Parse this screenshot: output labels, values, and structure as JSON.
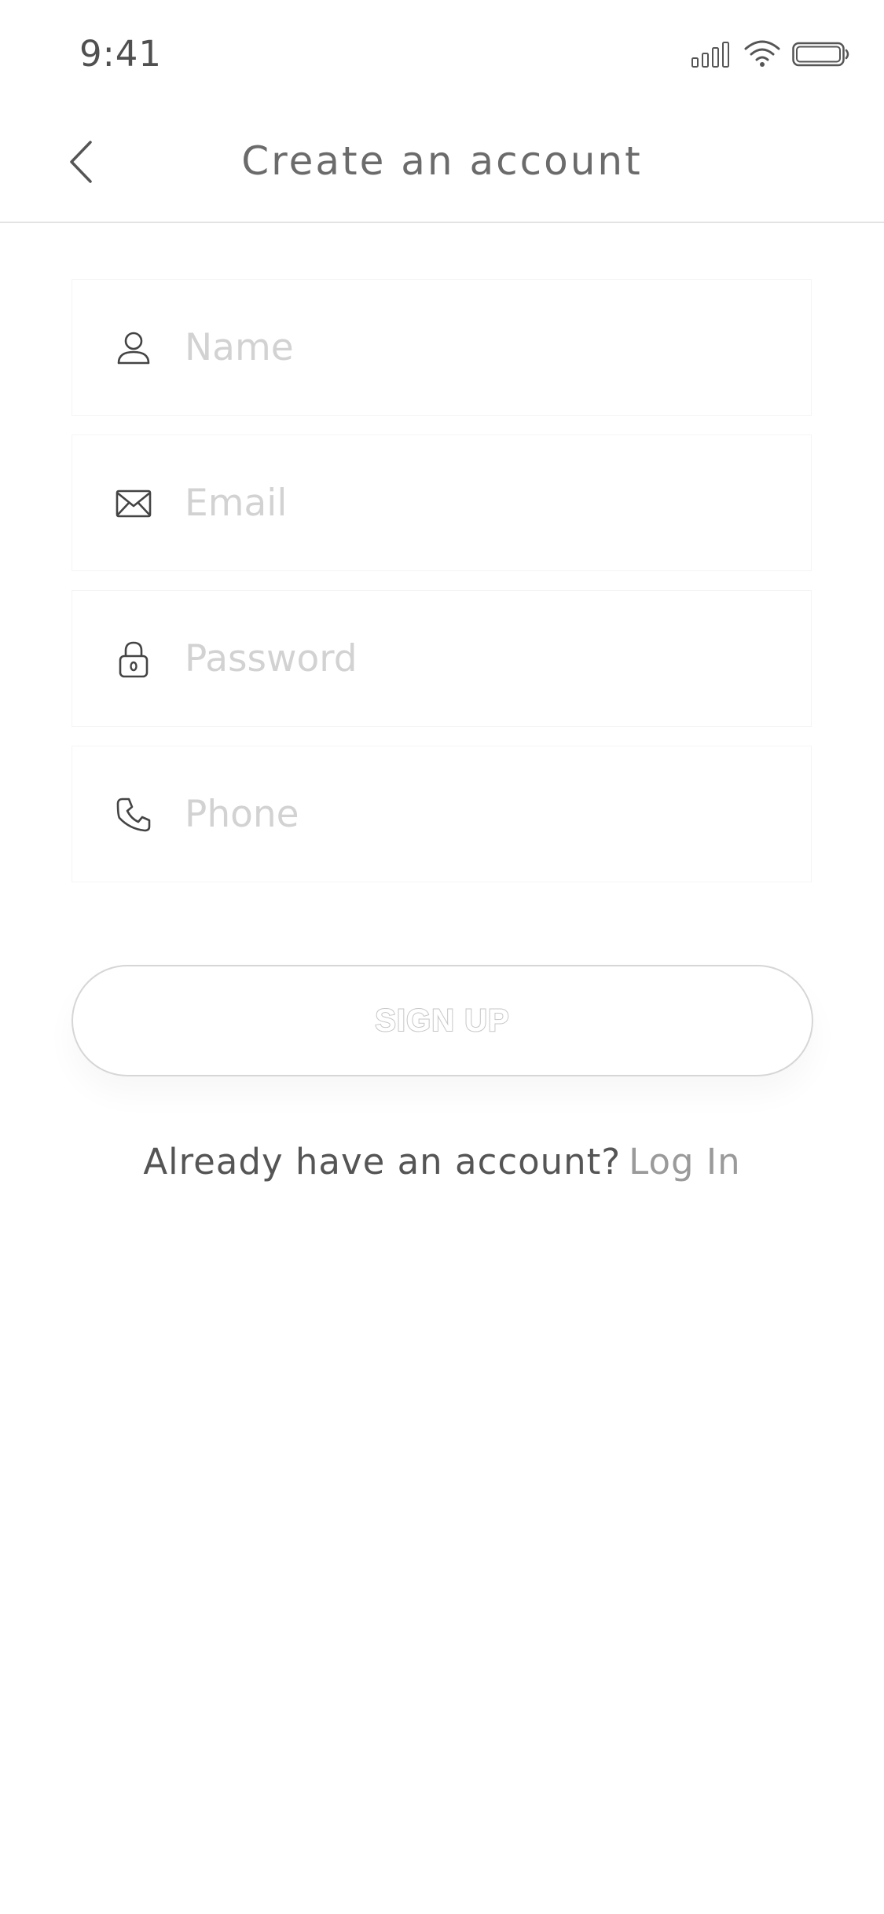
{
  "status_bar": {
    "time": "9:41",
    "icons": [
      "signal-icon",
      "wifi-icon",
      "battery-icon"
    ]
  },
  "nav": {
    "back_icon": "chevron-left-icon",
    "title": "Create an account"
  },
  "form": {
    "fields": [
      {
        "icon": "user-icon",
        "placeholder": "Name",
        "value": ""
      },
      {
        "icon": "envelope-icon",
        "placeholder": "Email",
        "value": ""
      },
      {
        "icon": "lock-icon",
        "placeholder": "Password",
        "value": ""
      },
      {
        "icon": "phone-icon",
        "placeholder": "Phone",
        "value": ""
      }
    ]
  },
  "signup": {
    "label": "SIGN UP"
  },
  "footer": {
    "prompt": "Already have an account?",
    "link": "Log In"
  },
  "colors": {
    "text": "#4a4a4a",
    "placeholder": "#d2d2d2",
    "divider": "#e3e3e3",
    "link": "#9a9a9a",
    "button_border": "#d6d6d6"
  }
}
